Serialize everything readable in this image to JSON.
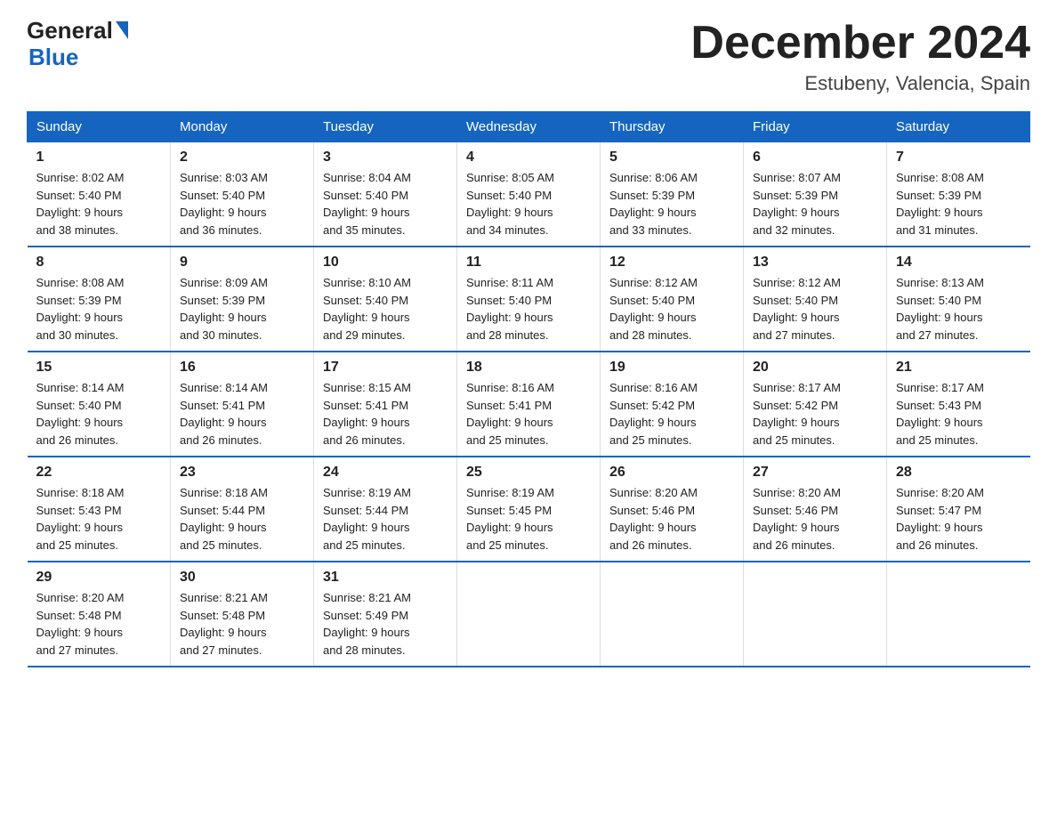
{
  "header": {
    "logo_line1": "General",
    "logo_line2": "Blue",
    "month_title": "December 2024",
    "location": "Estubeny, Valencia, Spain"
  },
  "days_of_week": [
    "Sunday",
    "Monday",
    "Tuesday",
    "Wednesday",
    "Thursday",
    "Friday",
    "Saturday"
  ],
  "weeks": [
    [
      {
        "num": "1",
        "sunrise": "8:02 AM",
        "sunset": "5:40 PM",
        "daylight": "9 hours and 38 minutes."
      },
      {
        "num": "2",
        "sunrise": "8:03 AM",
        "sunset": "5:40 PM",
        "daylight": "9 hours and 36 minutes."
      },
      {
        "num": "3",
        "sunrise": "8:04 AM",
        "sunset": "5:40 PM",
        "daylight": "9 hours and 35 minutes."
      },
      {
        "num": "4",
        "sunrise": "8:05 AM",
        "sunset": "5:40 PM",
        "daylight": "9 hours and 34 minutes."
      },
      {
        "num": "5",
        "sunrise": "8:06 AM",
        "sunset": "5:39 PM",
        "daylight": "9 hours and 33 minutes."
      },
      {
        "num": "6",
        "sunrise": "8:07 AM",
        "sunset": "5:39 PM",
        "daylight": "9 hours and 32 minutes."
      },
      {
        "num": "7",
        "sunrise": "8:08 AM",
        "sunset": "5:39 PM",
        "daylight": "9 hours and 31 minutes."
      }
    ],
    [
      {
        "num": "8",
        "sunrise": "8:08 AM",
        "sunset": "5:39 PM",
        "daylight": "9 hours and 30 minutes."
      },
      {
        "num": "9",
        "sunrise": "8:09 AM",
        "sunset": "5:39 PM",
        "daylight": "9 hours and 30 minutes."
      },
      {
        "num": "10",
        "sunrise": "8:10 AM",
        "sunset": "5:40 PM",
        "daylight": "9 hours and 29 minutes."
      },
      {
        "num": "11",
        "sunrise": "8:11 AM",
        "sunset": "5:40 PM",
        "daylight": "9 hours and 28 minutes."
      },
      {
        "num": "12",
        "sunrise": "8:12 AM",
        "sunset": "5:40 PM",
        "daylight": "9 hours and 28 minutes."
      },
      {
        "num": "13",
        "sunrise": "8:12 AM",
        "sunset": "5:40 PM",
        "daylight": "9 hours and 27 minutes."
      },
      {
        "num": "14",
        "sunrise": "8:13 AM",
        "sunset": "5:40 PM",
        "daylight": "9 hours and 27 minutes."
      }
    ],
    [
      {
        "num": "15",
        "sunrise": "8:14 AM",
        "sunset": "5:40 PM",
        "daylight": "9 hours and 26 minutes."
      },
      {
        "num": "16",
        "sunrise": "8:14 AM",
        "sunset": "5:41 PM",
        "daylight": "9 hours and 26 minutes."
      },
      {
        "num": "17",
        "sunrise": "8:15 AM",
        "sunset": "5:41 PM",
        "daylight": "9 hours and 26 minutes."
      },
      {
        "num": "18",
        "sunrise": "8:16 AM",
        "sunset": "5:41 PM",
        "daylight": "9 hours and 25 minutes."
      },
      {
        "num": "19",
        "sunrise": "8:16 AM",
        "sunset": "5:42 PM",
        "daylight": "9 hours and 25 minutes."
      },
      {
        "num": "20",
        "sunrise": "8:17 AM",
        "sunset": "5:42 PM",
        "daylight": "9 hours and 25 minutes."
      },
      {
        "num": "21",
        "sunrise": "8:17 AM",
        "sunset": "5:43 PM",
        "daylight": "9 hours and 25 minutes."
      }
    ],
    [
      {
        "num": "22",
        "sunrise": "8:18 AM",
        "sunset": "5:43 PM",
        "daylight": "9 hours and 25 minutes."
      },
      {
        "num": "23",
        "sunrise": "8:18 AM",
        "sunset": "5:44 PM",
        "daylight": "9 hours and 25 minutes."
      },
      {
        "num": "24",
        "sunrise": "8:19 AM",
        "sunset": "5:44 PM",
        "daylight": "9 hours and 25 minutes."
      },
      {
        "num": "25",
        "sunrise": "8:19 AM",
        "sunset": "5:45 PM",
        "daylight": "9 hours and 25 minutes."
      },
      {
        "num": "26",
        "sunrise": "8:20 AM",
        "sunset": "5:46 PM",
        "daylight": "9 hours and 26 minutes."
      },
      {
        "num": "27",
        "sunrise": "8:20 AM",
        "sunset": "5:46 PM",
        "daylight": "9 hours and 26 minutes."
      },
      {
        "num": "28",
        "sunrise": "8:20 AM",
        "sunset": "5:47 PM",
        "daylight": "9 hours and 26 minutes."
      }
    ],
    [
      {
        "num": "29",
        "sunrise": "8:20 AM",
        "sunset": "5:48 PM",
        "daylight": "9 hours and 27 minutes."
      },
      {
        "num": "30",
        "sunrise": "8:21 AM",
        "sunset": "5:48 PM",
        "daylight": "9 hours and 27 minutes."
      },
      {
        "num": "31",
        "sunrise": "8:21 AM",
        "sunset": "5:49 PM",
        "daylight": "9 hours and 28 minutes."
      },
      null,
      null,
      null,
      null
    ]
  ],
  "labels": {
    "sunrise": "Sunrise:",
    "sunset": "Sunset:",
    "daylight": "Daylight:"
  }
}
